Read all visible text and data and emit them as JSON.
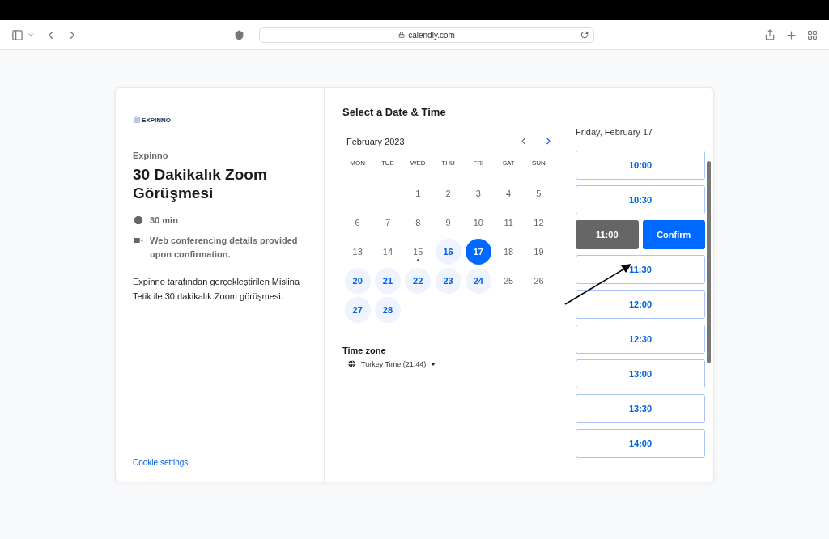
{
  "browser": {
    "address": "calendly.com"
  },
  "sidebar": {
    "logo": "EXPINNO",
    "organizer": "Expinno",
    "title": "30 Dakikalık Zoom Görüşmesi",
    "details": [
      {
        "kind": "duration",
        "text": "30 min"
      },
      {
        "kind": "video",
        "text": "Web conferencing details provided upon confirmation."
      }
    ],
    "description": "Expinno tarafından gerçekleştirilen Mislina Tetik ile 30 dakikalık Zoom görüşmesi.",
    "cookie_link": "Cookie settings"
  },
  "heading": "Select a Date & Time",
  "calendar": {
    "month": "February 2023",
    "prev_disabled": true,
    "weekdays": [
      "MON",
      "TUE",
      "WED",
      "THU",
      "FRI",
      "SAT",
      "SUN"
    ],
    "weeks": [
      {
        "days": [
          {
            "label": "1",
            "available": false,
            "selected": false,
            "today": false
          },
          {
            "label": "2",
            "available": false,
            "selected": false,
            "today": false
          },
          {
            "label": "3",
            "available": false,
            "selected": false,
            "today": false
          },
          {
            "label": "4",
            "available": false,
            "selected": false,
            "today": false
          },
          {
            "label": "5",
            "available": false,
            "selected": false,
            "today": false
          }
        ]
      },
      {
        "days": [
          {
            "label": "6",
            "available": false,
            "selected": false,
            "today": false
          },
          {
            "label": "7",
            "available": false,
            "selected": false,
            "today": false
          },
          {
            "label": "8",
            "available": false,
            "selected": false,
            "today": false
          },
          {
            "label": "9",
            "available": false,
            "selected": false,
            "today": false
          },
          {
            "label": "10",
            "available": false,
            "selected": false,
            "today": false
          },
          {
            "label": "11",
            "available": false,
            "selected": false,
            "today": false
          },
          {
            "label": "12",
            "available": false,
            "selected": false,
            "today": false
          }
        ]
      },
      {
        "days": [
          {
            "label": "13",
            "available": false,
            "selected": false,
            "today": false
          },
          {
            "label": "14",
            "available": false,
            "selected": false,
            "today": false
          },
          {
            "label": "15",
            "available": false,
            "selected": false,
            "today": true
          },
          {
            "label": "16",
            "available": true,
            "selected": false,
            "today": false
          },
          {
            "label": "17",
            "available": true,
            "selected": true,
            "today": false
          },
          {
            "label": "18",
            "available": false,
            "selected": false,
            "today": false
          },
          {
            "label": "19",
            "available": false,
            "selected": false,
            "today": false
          }
        ]
      },
      {
        "days": [
          {
            "label": "20",
            "available": true,
            "selected": false,
            "today": false
          },
          {
            "label": "21",
            "available": true,
            "selected": false,
            "today": false
          },
          {
            "label": "22",
            "available": true,
            "selected": false,
            "today": false
          },
          {
            "label": "23",
            "available": true,
            "selected": false,
            "today": false
          },
          {
            "label": "24",
            "available": true,
            "selected": false,
            "today": false
          },
          {
            "label": "25",
            "available": false,
            "selected": false,
            "today": false
          },
          {
            "label": "26",
            "available": false,
            "selected": false,
            "today": false
          }
        ]
      },
      {
        "days": [
          {
            "label": "27",
            "available": true,
            "selected": false,
            "today": false
          },
          {
            "label": "28",
            "available": true,
            "selected": false,
            "today": false
          }
        ]
      }
    ]
  },
  "timezone": {
    "label": "Time zone",
    "value": "Turkey Time (21:44)"
  },
  "slots": {
    "date": "Friday, February 17",
    "times": [
      {
        "label": "10:00",
        "selected": false
      },
      {
        "label": "10:30",
        "selected": false
      },
      {
        "label": "11:00",
        "selected": true,
        "confirm": "Confirm"
      },
      {
        "label": "11:30",
        "selected": false
      },
      {
        "label": "12:00",
        "selected": false
      },
      {
        "label": "12:30",
        "selected": false
      },
      {
        "label": "13:00",
        "selected": false
      },
      {
        "label": "13:30",
        "selected": false
      },
      {
        "label": "14:00",
        "selected": false
      }
    ]
  }
}
